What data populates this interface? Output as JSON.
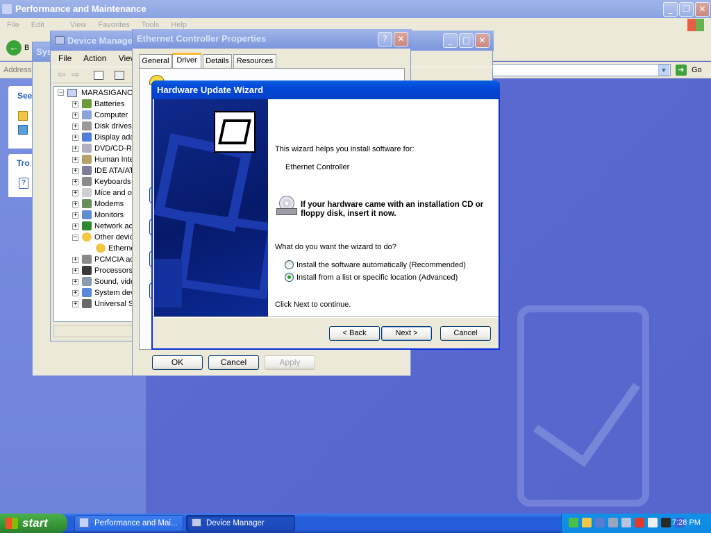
{
  "perf_window": {
    "title": "Performance and Maintenance",
    "menu": [
      "File",
      "Edit",
      "View",
      "Favorites",
      "Tools",
      "Help"
    ],
    "back_label": "B",
    "address_label": "Address",
    "go_label": "Go",
    "sidebar_see": "See",
    "sidebar_tro": "Tro"
  },
  "system_window": {
    "title_fragment": "Sys"
  },
  "device_manager": {
    "title": "Device Manager",
    "menu": [
      "File",
      "Action",
      "View"
    ],
    "root": "MARASIGANCO",
    "items": [
      {
        "label": "Batteries",
        "expander": "+"
      },
      {
        "label": "Computer",
        "expander": "+"
      },
      {
        "label": "Disk drives",
        "expander": "+"
      },
      {
        "label": "Display ada",
        "expander": "+"
      },
      {
        "label": "DVD/CD-RO",
        "expander": "+"
      },
      {
        "label": "Human Inte",
        "expander": "+"
      },
      {
        "label": "IDE ATA/AT",
        "expander": "+"
      },
      {
        "label": "Keyboards",
        "expander": "+"
      },
      {
        "label": "Mice and ot",
        "expander": "+"
      },
      {
        "label": "Modems",
        "expander": "+"
      },
      {
        "label": "Monitors",
        "expander": "+"
      },
      {
        "label": "Network ac",
        "expander": "+"
      },
      {
        "label": "Other devic",
        "expander": "−"
      },
      {
        "label": "Etherne",
        "expander": ""
      },
      {
        "label": "PCMCIA ad",
        "expander": "+"
      },
      {
        "label": "Processors",
        "expander": "+"
      },
      {
        "label": "Sound, vide",
        "expander": "+"
      },
      {
        "label": "System dev",
        "expander": "+"
      },
      {
        "label": "Universal S",
        "expander": "+"
      }
    ]
  },
  "props_dialog": {
    "title": "Ethernet Controller Properties",
    "help_glyph": "?",
    "tabs": [
      "General",
      "Driver",
      "Details",
      "Resources"
    ],
    "active_tab": "Driver",
    "ok": "OK",
    "cancel": "Cancel",
    "apply": "Apply"
  },
  "wizard": {
    "title": "Hardware Update Wizard",
    "intro": "This wizard helps you install software for:",
    "device": "Ethernet Controller",
    "cd_notice": "If your hardware came with an installation CD or floppy disk, insert it now.",
    "question": "What do you want the wizard to do?",
    "options": [
      {
        "label": "Install the software automatically (Recommended)",
        "selected": false
      },
      {
        "label": "Install from a list or specific location (Advanced)",
        "selected": true
      }
    ],
    "continue_text": "Click Next to continue.",
    "back": "< Back",
    "next": "Next >",
    "cancel": "Cancel"
  },
  "taskbar": {
    "start": "start",
    "tasks": [
      "Performance and Mai...",
      "Device Manager"
    ],
    "clock": "7:28 PM"
  },
  "colors": {
    "desktop": "#5a6fd0",
    "xp_blue": "#0447d8",
    "taskbar": "#245edb",
    "start_green": "#3c9a3c",
    "tray": "#0f8ae8"
  }
}
